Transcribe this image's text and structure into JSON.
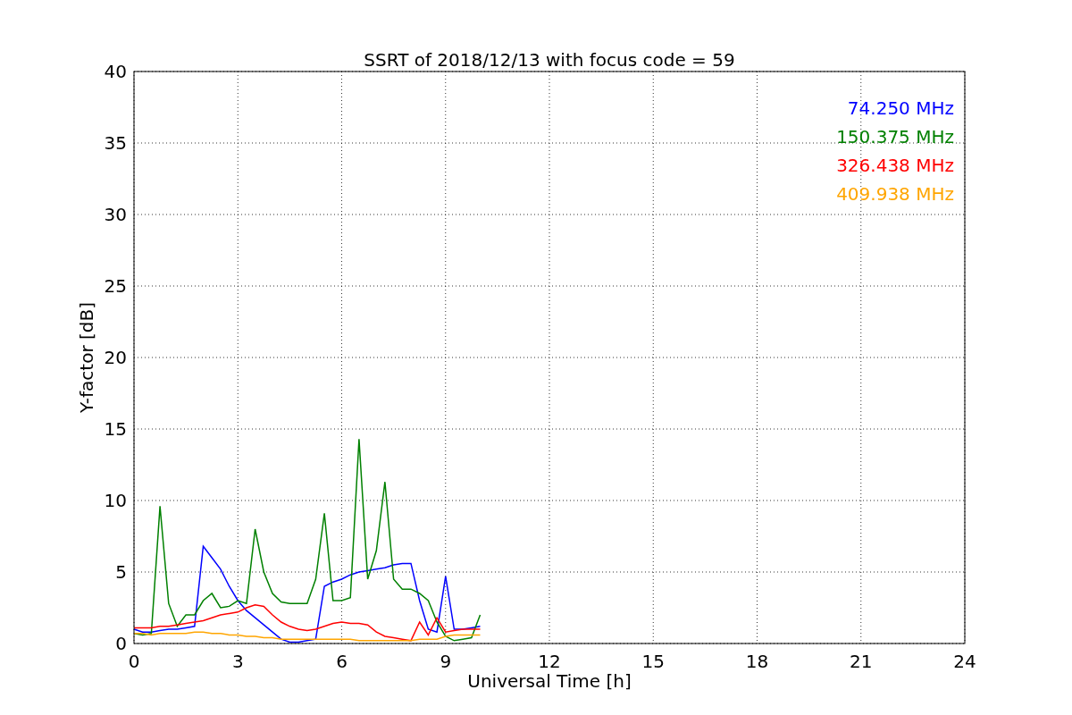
{
  "chart_data": {
    "type": "line",
    "title": "SSRT of 2018/12/13 with focus code = 59",
    "xlabel": "Universal Time [h]",
    "ylabel": "Y-factor [dB]",
    "x": [
      0,
      0.25,
      0.5,
      0.75,
      1,
      1.25,
      1.5,
      1.75,
      2,
      2.25,
      2.5,
      2.75,
      3,
      3.25,
      3.5,
      3.75,
      4,
      4.25,
      4.5,
      4.75,
      5,
      5.25,
      5.5,
      5.75,
      6,
      6.25,
      6.5,
      6.75,
      7,
      7.25,
      7.5,
      7.75,
      8,
      8.25,
      8.5,
      8.75,
      9,
      9.25,
      9.5,
      9.75,
      10
    ],
    "series": [
      {
        "name": "74.250 MHz",
        "color": "#0000ff",
        "values": [
          1.0,
          0.8,
          0.8,
          0.9,
          1.0,
          1.0,
          1.1,
          1.2,
          6.8,
          6.0,
          5.2,
          4.0,
          3.0,
          2.3,
          1.8,
          1.3,
          0.8,
          0.3,
          0.1,
          0.1,
          0.2,
          0.3,
          4.0,
          4.3,
          4.5,
          4.8,
          5.0,
          5.1,
          5.2,
          5.3,
          5.5,
          5.6,
          5.6,
          3.0,
          1.0,
          0.8,
          4.7,
          1.0,
          1.0,
          1.1,
          1.2
        ]
      },
      {
        "name": "150.375 MHz",
        "color": "#008000",
        "values": [
          0.7,
          0.6,
          0.7,
          9.6,
          2.8,
          1.2,
          2.0,
          2.0,
          3.0,
          3.5,
          2.5,
          2.6,
          3.0,
          2.8,
          8.0,
          5.0,
          3.5,
          2.9,
          2.8,
          2.8,
          2.8,
          4.5,
          9.1,
          3.0,
          3.0,
          3.2,
          14.3,
          4.5,
          6.5,
          11.3,
          4.5,
          3.8,
          3.8,
          3.5,
          3.0,
          1.5,
          0.5,
          0.2,
          0.3,
          0.4,
          2.0
        ]
      },
      {
        "name": "326.438 MHz",
        "color": "#ff0000",
        "values": [
          1.1,
          1.1,
          1.1,
          1.2,
          1.2,
          1.3,
          1.4,
          1.5,
          1.6,
          1.8,
          2.0,
          2.1,
          2.2,
          2.5,
          2.7,
          2.6,
          2.0,
          1.5,
          1.2,
          1.0,
          0.9,
          1.0,
          1.2,
          1.4,
          1.5,
          1.4,
          1.4,
          1.3,
          0.8,
          0.5,
          0.4,
          0.3,
          0.2,
          1.5,
          0.6,
          1.8,
          0.8,
          0.9,
          1.0,
          1.0,
          1.0
        ]
      },
      {
        "name": "409.938 MHz",
        "color": "#ffa500",
        "values": [
          0.7,
          0.7,
          0.6,
          0.7,
          0.7,
          0.7,
          0.7,
          0.8,
          0.8,
          0.7,
          0.7,
          0.6,
          0.6,
          0.5,
          0.5,
          0.4,
          0.4,
          0.3,
          0.3,
          0.3,
          0.3,
          0.3,
          0.3,
          0.3,
          0.3,
          0.3,
          0.2,
          0.2,
          0.2,
          0.2,
          0.2,
          0.2,
          0.2,
          0.3,
          0.3,
          0.3,
          0.5,
          0.6,
          0.6,
          0.6,
          0.6
        ]
      }
    ],
    "grid": true,
    "xlim": [
      0,
      24
    ],
    "ylim": [
      0,
      40
    ],
    "xticks": [
      0,
      3,
      6,
      9,
      12,
      15,
      18,
      21,
      24
    ],
    "yticks": [
      0,
      5,
      10,
      15,
      20,
      25,
      30,
      35,
      40
    ]
  }
}
